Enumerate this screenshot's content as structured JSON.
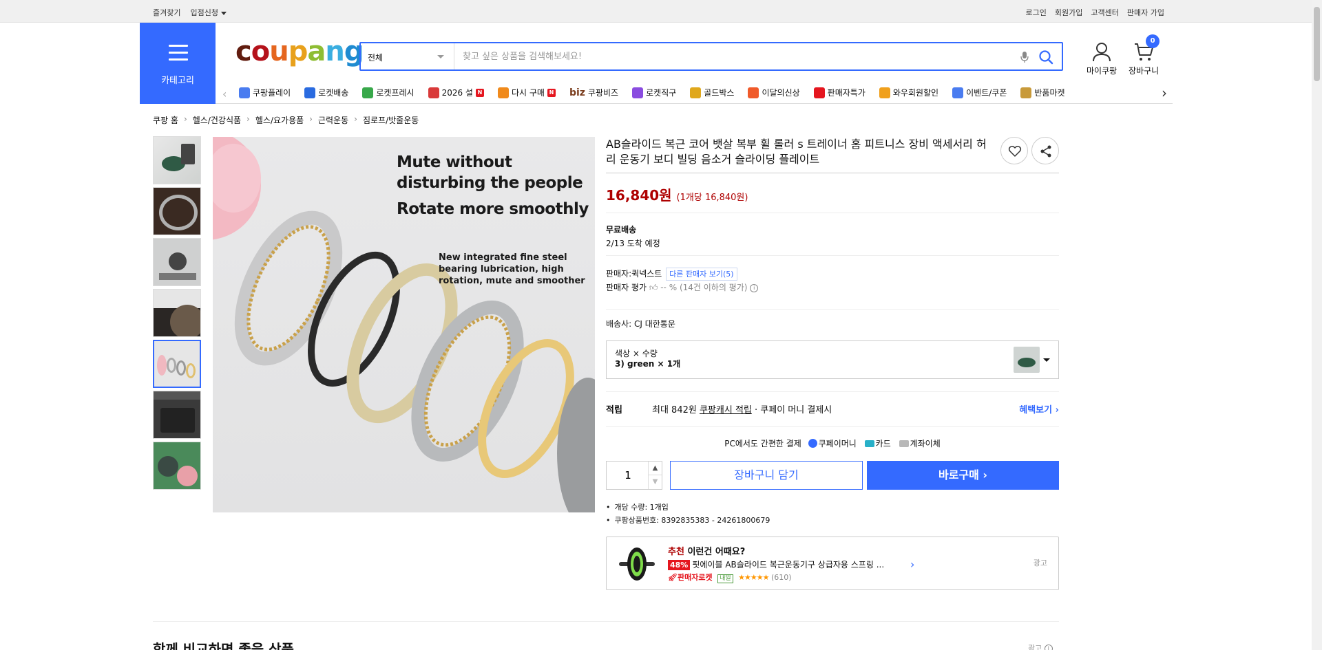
{
  "topbar": {
    "left": [
      "즐겨찾기",
      "입점신청"
    ],
    "right": [
      "로그인",
      "회원가입",
      "고객센터",
      "판매자 가입"
    ]
  },
  "header": {
    "category_label": "카테고리",
    "logo": [
      "c",
      "o",
      "u",
      "p",
      "a",
      "n",
      "g"
    ],
    "search_category": "전체",
    "search_placeholder": "찾고 싶은 상품을 검색해보세요!",
    "mycoupang_label": "마이쿠팡",
    "cart_label": "장바구니",
    "cart_count": "0"
  },
  "nav": [
    {
      "label": "쿠팡플레이",
      "icon": "play-icon",
      "color": "#4a7cf0",
      "badge": ""
    },
    {
      "label": "로켓배송",
      "icon": "rocket-icon",
      "color": "#2a6be0",
      "badge": ""
    },
    {
      "label": "로켓프레시",
      "icon": "rocket-fresh-icon",
      "color": "#38a84a",
      "badge": ""
    },
    {
      "label": "2026 설",
      "icon": "gift-icon",
      "color": "#d93a3a",
      "badge": "N"
    },
    {
      "label": "다시 구매",
      "icon": "house-icon",
      "color": "#f08a1c",
      "badge": "N"
    },
    {
      "label": "쿠팡비즈",
      "icon": "biz-icon",
      "color": "#7a3c1c",
      "badge": "",
      "prefix": "biz"
    },
    {
      "label": "로켓직구",
      "icon": "global-icon",
      "color": "#8a4ce0",
      "badge": ""
    },
    {
      "label": "골드박스",
      "icon": "goldbox-icon",
      "color": "#e0a81c",
      "badge": ""
    },
    {
      "label": "이달의신상",
      "icon": "new-icon",
      "color": "#f05a2a",
      "badge": ""
    },
    {
      "label": "판매자특가",
      "icon": "percent-icon",
      "color": "#e5161f",
      "badge": ""
    },
    {
      "label": "와우회원할인",
      "icon": "wow-icon",
      "color": "#f0a01c",
      "badge": ""
    },
    {
      "label": "이벤트/쿠폰",
      "icon": "coupon-icon",
      "color": "#4a7cf0",
      "badge": ""
    },
    {
      "label": "반품마켓",
      "icon": "market-icon",
      "color": "#c89a3a",
      "badge": ""
    }
  ],
  "breadcrumb": [
    "쿠팡 홈",
    "헬스/건강식품",
    "헬스/요가용품",
    "근력운동",
    "짐로프/밧줄운동"
  ],
  "image_text": {
    "line1": "Mute without",
    "line2": "disturbing the people",
    "line3": "Rotate more smoothly",
    "line4": "New integrated fine steel bearing lubrication, high rotation, mute and smoother"
  },
  "product": {
    "title": "AB슬라이드 복근 코어 뱃살 복부 휠 롤러 s 트레이너 홈 피트니스 장비 액세서리 허리 운동기 보디 빌딩 음소거 슬라이딩 플레이트",
    "price": "16,840원",
    "unit_price": "(1개당 16,840원)",
    "shipping_title": "무료배송",
    "arrival": "2/13 도착 예정",
    "seller_label": "판매자:",
    "seller_name": "퀵넥스트",
    "other_sellers": "다른 판매자 보기(5)",
    "seller_rating_label": "판매자 평가",
    "seller_rating_value": "-- %",
    "seller_rating_note": "(14건 이하의 평가)",
    "carrier": "배송사:  CJ 대한통운",
    "option_label": "색상 × 수량",
    "option_value": "3) green × 1개",
    "reward_label": "적립",
    "reward_prefix": "최대 842원",
    "reward_link": "쿠팡캐시 적립",
    "reward_suffix": "· 쿠페이 머니 결제시",
    "reward_more": "혜택보기",
    "pay_title": "PC에서도 간편한 결제",
    "pay_methods": [
      "쿠페이머니",
      "카드",
      "계좌이체"
    ],
    "quantity": "1",
    "cart_button": "장바구니 담기",
    "buy_button": "바로구매",
    "specs": [
      "개당 수량: 1개입",
      "쿠팡상품번호: 8392835383 - 24261800679"
    ]
  },
  "recommend": {
    "title_red": "추천",
    "title_rest": " 이런건 어때요?",
    "discount": "48%",
    "name": "핏에이블 AB슬라이드 복근운동기구 상급자용 스프링 ...",
    "rocket": "판매자로켓",
    "tag": "내일",
    "stars": "★★★★★",
    "rating": 4.5,
    "reviews": "(610)",
    "ad": "광고"
  },
  "section": {
    "title": "함께 비교하면 좋을 상품",
    "ad": "광고"
  },
  "colors": {
    "accent": "#346aff",
    "price": "#ae0000"
  }
}
